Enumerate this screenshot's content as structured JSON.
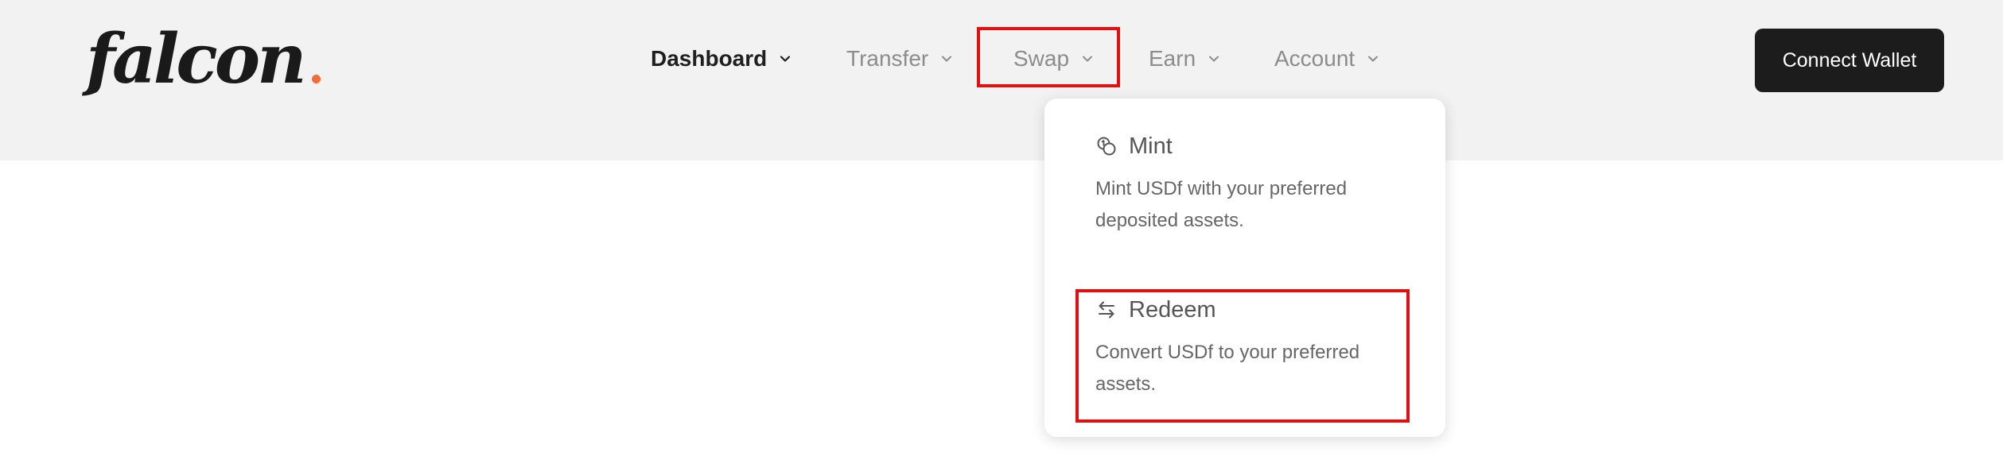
{
  "brand": {
    "logo_text": "falcon",
    "accent_color": "#f26b3a"
  },
  "nav": {
    "items": [
      {
        "label": "Dashboard",
        "active": true
      },
      {
        "label": "Transfer",
        "active": false
      },
      {
        "label": "Swap",
        "active": false,
        "highlighted": true
      },
      {
        "label": "Earn",
        "active": false
      },
      {
        "label": "Account",
        "active": false
      }
    ],
    "chevron_icon": "chevron-down-icon"
  },
  "header": {
    "connect_label": "Connect Wallet"
  },
  "dropdown": {
    "items": [
      {
        "icon": "coins-icon",
        "title": "Mint",
        "description": "Mint USDf with your preferred deposited assets."
      },
      {
        "icon": "swap-arrows-icon",
        "title": "Redeem",
        "description": "Convert USDf to your preferred assets.",
        "highlighted": true
      }
    ]
  },
  "colors": {
    "header_bg": "#f2f2f2",
    "button_bg": "#1c1c1c",
    "highlight_border": "#e01010"
  }
}
